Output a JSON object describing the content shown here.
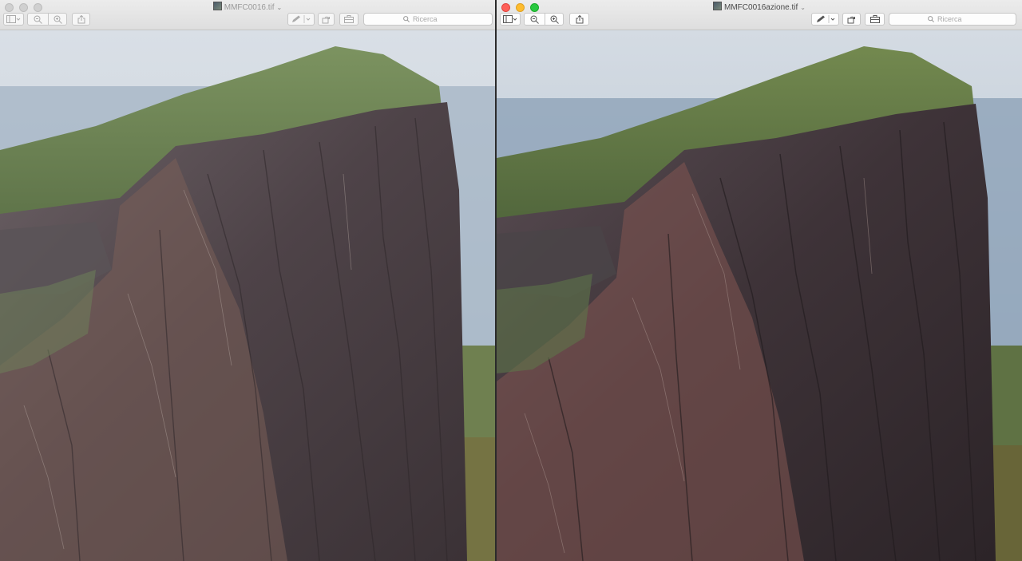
{
  "windows": [
    {
      "id": "left",
      "title": "MMFC0016.tif",
      "active": false,
      "search_placeholder": "Ricerca",
      "icons": [
        "sidebar-toggle-icon",
        "zoom-out-icon",
        "zoom-in-icon",
        "share-icon",
        "markup-pen-icon",
        "rotate-icon",
        "toolbox-icon",
        "search-icon"
      ]
    },
    {
      "id": "right",
      "title": "MMFC0016azione.tif",
      "active": true,
      "search_placeholder": "Ricerca",
      "icons": [
        "sidebar-toggle-icon",
        "zoom-out-icon",
        "zoom-in-icon",
        "share-icon",
        "markup-pen-icon",
        "rotate-icon",
        "toolbox-icon",
        "search-icon"
      ]
    }
  ],
  "colors": {
    "sky": "#cfd8e0",
    "sea": "#8ea3b8",
    "grass": "#6e8a4e",
    "rock_dark": "#4a3f44",
    "rock_pink": "#8a6860",
    "rock_light": "#a89c96"
  }
}
